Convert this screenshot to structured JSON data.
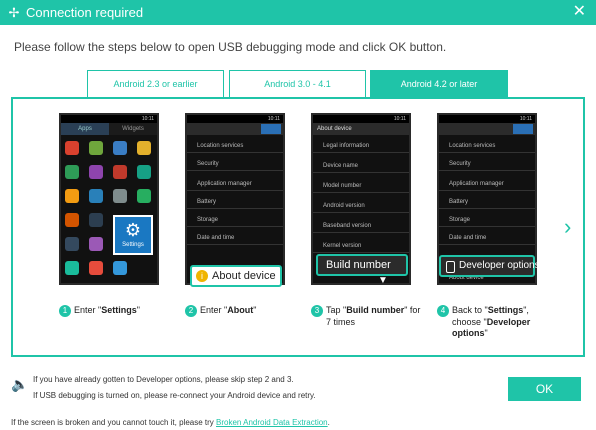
{
  "window": {
    "title": "Connection required",
    "close_glyph": "✕",
    "logo_glyph": "✢"
  },
  "instruction": "Please follow the steps below to open USB debugging mode and click OK button.",
  "tabs": [
    {
      "label": "Android 2.3 or earlier",
      "active": false
    },
    {
      "label": "Android 3.0 - 4.1",
      "active": false
    },
    {
      "label": "Android 4.2 or later",
      "active": true
    }
  ],
  "phones": {
    "p1": {
      "tab_apps": "Apps",
      "tab_widgets": "Widgets",
      "tile": "Settings",
      "time": "10:11"
    },
    "p2": {
      "rows": [
        "Location services",
        "Security",
        "Application manager",
        "Battery",
        "Storage",
        "Date and time"
      ],
      "highlight": "About device",
      "time": "10:11"
    },
    "p3": {
      "rows": [
        "Legal information",
        "Device name",
        "Model number",
        "Android version",
        "Baseband version",
        "Kernel version"
      ],
      "header": "About device",
      "highlight": "Build number",
      "time": "10:11"
    },
    "p4": {
      "rows": [
        "Location services",
        "Security",
        "Application manager",
        "Battery",
        "Storage",
        "Date and time"
      ],
      "highlight": "Developer options",
      "last_row": "About device",
      "time": "10:11"
    }
  },
  "steps": [
    {
      "num": "1",
      "pre": "Enter \"",
      "bold": "Settings",
      "post": "\""
    },
    {
      "num": "2",
      "pre": "Enter \"",
      "bold": "About",
      "post": "\""
    },
    {
      "num": "3",
      "pre": "Tap \"",
      "bold": "Build number",
      "post": "\" for",
      "line2": "7 times"
    },
    {
      "num": "4",
      "pre": "Back to \"",
      "bold": "Settings",
      "post": "\",",
      "line2": "choose \"",
      "bold2": "Developer",
      "line3bold": "options",
      "line3": "\""
    }
  ],
  "notes": {
    "line1": "If you have already gotten to Developer options, please skip step 2 and 3.",
    "line2": "If USB debugging is turned on, please re-connect your Android device and retry."
  },
  "ok_label": "OK",
  "footer": {
    "text": "If the screen is broken and you cannot touch it, please try ",
    "link": "Broken Android Data Extraction",
    "suffix": "."
  },
  "icons": {
    "next": "›",
    "speaker": "🔈"
  },
  "colors": {
    "accent": "#1fc4a8"
  }
}
